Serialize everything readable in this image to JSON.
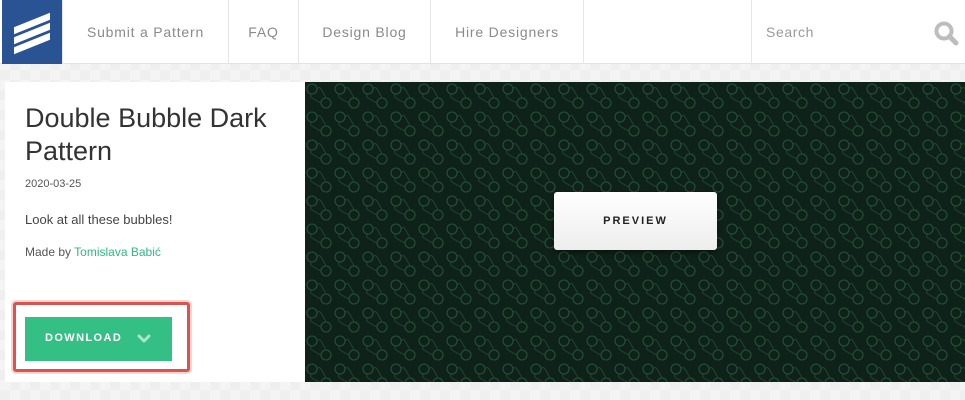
{
  "nav": {
    "logo_icon": "stripes-logo-icon",
    "items": [
      {
        "label": "Submit a Pattern"
      },
      {
        "label": "FAQ"
      },
      {
        "label": "Design Blog"
      },
      {
        "label": "Hire Designers"
      }
    ],
    "search": {
      "placeholder": "Search",
      "icon": "search-icon"
    }
  },
  "pattern": {
    "title": "Double Bubble Dark Pattern",
    "date": "2020-03-25",
    "description": "Look at all these bubbles!",
    "made_by_prefix": "Made by",
    "author": "Tomislava Babić",
    "download_label": "DOWNLOAD",
    "download_icon": "chevron-down-icon",
    "preview_label": "PREVIEW"
  },
  "colors": {
    "logo_bg": "#2a5394",
    "accent_green": "#34bf85",
    "link_green": "#2eb980",
    "preview_bg": "#0f2219",
    "pattern_stroke": "#24513a",
    "highlight_red": "#d9534f"
  }
}
